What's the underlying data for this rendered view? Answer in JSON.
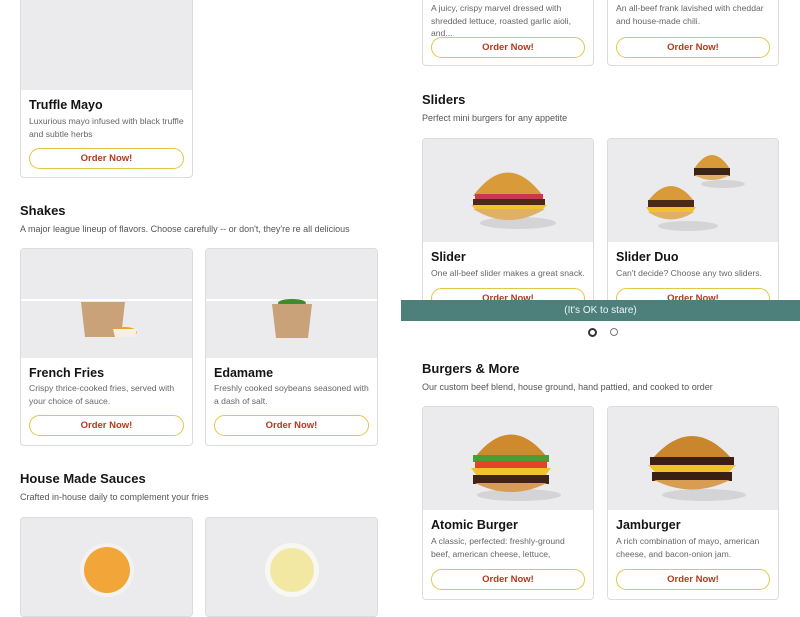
{
  "cards": {
    "truffle_mayo": {
      "title": "Truffle Mayo",
      "desc": "Luxurious mayo infused with black truffle and subtle herbs",
      "button": "Order Now!"
    },
    "top_left": {
      "desc": "A juicy, crispy marvel dressed with shredded lettuce, roasted garlic aioli, and...",
      "button": "Order Now!"
    },
    "top_right": {
      "desc": "An all-beef frank lavished with cheddar and house-made chili.",
      "button": "Order Now!"
    },
    "slider": {
      "title": "Slider",
      "desc": "One all-beef slider makes a great snack.",
      "button": "Order Now!"
    },
    "slider_duo": {
      "title": "Slider Duo",
      "desc": "Can't decide? Choose any two sliders.",
      "button": "Order Now!"
    },
    "french_fries": {
      "title": "French Fries",
      "desc": "Crispy thrice-cooked fries, served with your choice of sauce.",
      "button": "Order Now!"
    },
    "edamame": {
      "title": "Edamame",
      "desc": "Freshly cooked soybeans seasoned with a dash of salt.",
      "button": "Order Now!"
    },
    "atomic_burger": {
      "title": "Atomic Burger",
      "desc": "A classic, perfected: freshly-ground beef, american cheese, lettuce, tomatoes,...",
      "button": "Order Now!"
    },
    "jamburger": {
      "title": "Jamburger",
      "desc": "A rich combination of mayo, american cheese, and bacon-onion jam.",
      "button": "Order Now!"
    }
  },
  "sections": {
    "sliders": {
      "title": "Sliders",
      "subtitle": "Perfect mini burgers for any appetite"
    },
    "shakes": {
      "title": "Shakes",
      "subtitle": "A major league lineup of flavors. Choose carefully -- or don't, they're re all delicious"
    },
    "sauces": {
      "title": "House Made Sauces",
      "subtitle": "Crafted in-house daily to complement your fries"
    },
    "burgers": {
      "title": "Burgers & More",
      "subtitle": "Our custom beef blend, house ground, hand pattied, and cooked to order"
    }
  },
  "banner": {
    "text": "(It's OK to stare)"
  },
  "carousel": {
    "dots": 2,
    "active": 1
  },
  "colors": {
    "accent_text": "#b33a1e",
    "button_border": "#e0c84a",
    "banner": "#4e807b",
    "card_image_bg": "#ebebed"
  },
  "icons": [
    "burger-image",
    "slider-image",
    "fries-image",
    "edamame-image",
    "sauce-image",
    "mayo-image"
  ]
}
